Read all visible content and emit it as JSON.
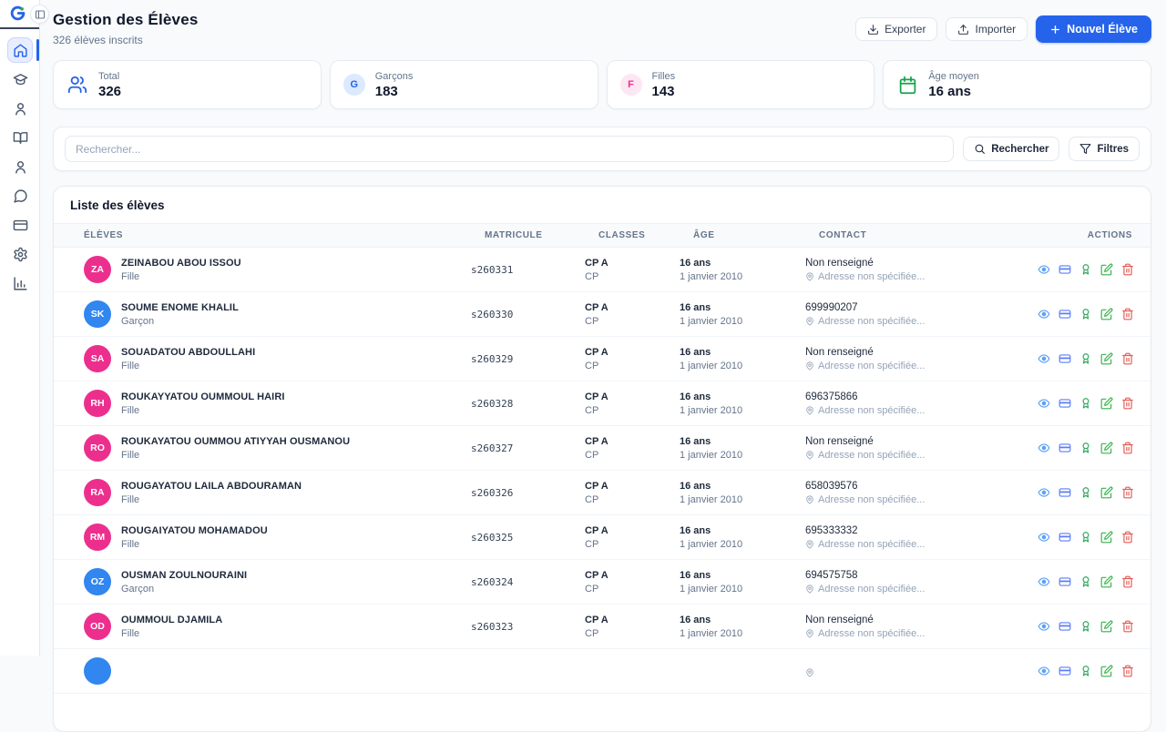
{
  "app": {
    "logo_letter": "G",
    "sidebar_icons": [
      "home",
      "graduation-cap",
      "student-user",
      "book-open",
      "teacher-user",
      "messages",
      "payments-card",
      "settings-gear",
      "statistics-chart"
    ],
    "sidebar_active": "home"
  },
  "header": {
    "title": "Gestion des Élèves",
    "subtitle": "326 élèves inscrits",
    "export_label": "Exporter",
    "import_label": "Importer",
    "new_student_label": "Nouvel Élève"
  },
  "stats": {
    "total": {
      "label": "Total",
      "value": "326",
      "icon": "users-icon",
      "color": "#2563eb"
    },
    "boys": {
      "label": "Garçons",
      "value": "183",
      "badge": "G",
      "color": "#2563eb"
    },
    "girls": {
      "label": "Filles",
      "value": "143",
      "badge": "F",
      "color": "#ec2f8d"
    },
    "avg_age": {
      "label": "Âge moyen",
      "value": "16 ans",
      "icon": "calendar-icon",
      "color": "#16a34a"
    }
  },
  "search": {
    "placeholder": "Rechercher...",
    "search_label": "Rechercher",
    "filters_label": "Filtres"
  },
  "table": {
    "title": "Liste des élèves",
    "columns": [
      "ÉLÈVES",
      "MATRICULE",
      "CLASSES",
      "ÂGE",
      "CONTACT",
      "ACTIONS"
    ],
    "action_icons": [
      "view-eye",
      "card",
      "award",
      "edit",
      "delete"
    ],
    "rows": [
      {
        "initials": "ZA",
        "name": "ZEINABOU ABOU ISSOU",
        "gender": "Fille",
        "avatar": "pink",
        "matricule": "s260331",
        "class_main": "CP A",
        "class_sub": "CP",
        "age": "16 ans",
        "birthdate": "1 janvier 2010",
        "phone": "Non renseigné",
        "address": "Adresse non spécifiée..."
      },
      {
        "initials": "SK",
        "name": "SOUME ENOME KHALIL",
        "gender": "Garçon",
        "avatar": "blue",
        "matricule": "s260330",
        "class_main": "CP A",
        "class_sub": "CP",
        "age": "16 ans",
        "birthdate": "1 janvier 2010",
        "phone": "699990207",
        "address": "Adresse non spécifiée..."
      },
      {
        "initials": "SA",
        "name": "SOUADATOU ABDOULLAHI",
        "gender": "Fille",
        "avatar": "pink",
        "matricule": "s260329",
        "class_main": "CP A",
        "class_sub": "CP",
        "age": "16 ans",
        "birthdate": "1 janvier 2010",
        "phone": "Non renseigné",
        "address": "Adresse non spécifiée..."
      },
      {
        "initials": "RH",
        "name": "ROUKAYYATOU OUMMOUL HAIRI",
        "gender": "Fille",
        "avatar": "pink",
        "matricule": "s260328",
        "class_main": "CP A",
        "class_sub": "CP",
        "age": "16 ans",
        "birthdate": "1 janvier 2010",
        "phone": "696375866",
        "address": "Adresse non spécifiée..."
      },
      {
        "initials": "RO",
        "name": "ROUKAYATOU OUMMOU ATIYYAH OUSMANOU",
        "gender": "Fille",
        "avatar": "pink",
        "matricule": "s260327",
        "class_main": "CP A",
        "class_sub": "CP",
        "age": "16 ans",
        "birthdate": "1 janvier 2010",
        "phone": "Non renseigné",
        "address": "Adresse non spécifiée..."
      },
      {
        "initials": "RA",
        "name": "ROUGAYATOU LAILA ABDOURAMAN",
        "gender": "Fille",
        "avatar": "pink",
        "matricule": "s260326",
        "class_main": "CP A",
        "class_sub": "CP",
        "age": "16 ans",
        "birthdate": "1 janvier 2010",
        "phone": "658039576",
        "address": "Adresse non spécifiée..."
      },
      {
        "initials": "RM",
        "name": "ROUGAIYATOU MOHAMADOU",
        "gender": "Fille",
        "avatar": "pink",
        "matricule": "s260325",
        "class_main": "CP A",
        "class_sub": "CP",
        "age": "16 ans",
        "birthdate": "1 janvier 2010",
        "phone": "695333332",
        "address": "Adresse non spécifiée..."
      },
      {
        "initials": "OZ",
        "name": "OUSMAN ZOULNOURAINI",
        "gender": "Garçon",
        "avatar": "blue",
        "matricule": "s260324",
        "class_main": "CP A",
        "class_sub": "CP",
        "age": "16 ans",
        "birthdate": "1 janvier 2010",
        "phone": "694575758",
        "address": "Adresse non spécifiée..."
      },
      {
        "initials": "OD",
        "name": "OUMMOUL DJAMILA",
        "gender": "Fille",
        "avatar": "pink",
        "matricule": "s260323",
        "class_main": "CP A",
        "class_sub": "CP",
        "age": "16 ans",
        "birthdate": "1 janvier 2010",
        "phone": "Non renseigné",
        "address": "Adresse non spécifiée..."
      }
    ],
    "partial_row": {
      "avatar": "blue"
    }
  },
  "colors": {
    "primary_blue": "#2563eb",
    "avatar_pink": "#ec2f8d",
    "avatar_blue": "#3186f0",
    "green": "#16a34a",
    "background": "#f8fafc"
  }
}
